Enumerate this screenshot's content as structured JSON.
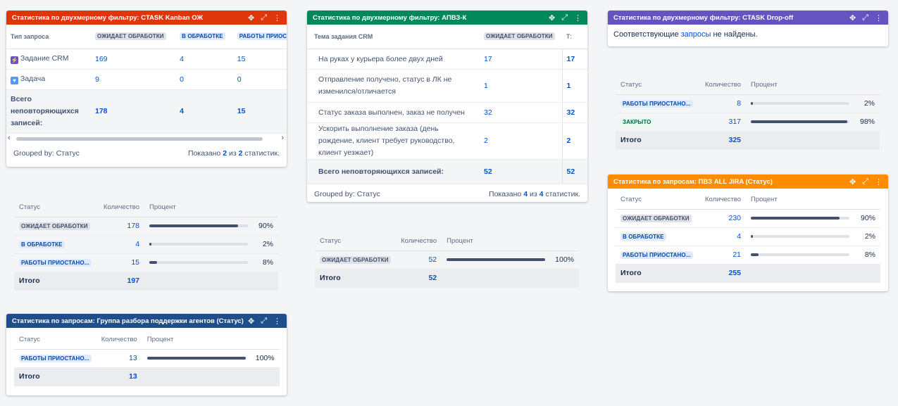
{
  "g1": {
    "title": "Статистика по двухмерному фильтру: CTASK Kanban ОЖ",
    "color": "#de350b",
    "col0": "Тип запроса",
    "cols": [
      "ОЖИДАЕТ ОБРАБОТКИ",
      "В ОБРАБОТКЕ",
      "РАБОТЫ ПРИОСТАН"
    ],
    "rows": [
      {
        "icon": "crm-task-icon",
        "name": "Задание CRM",
        "v": [
          "169",
          "4",
          "15"
        ]
      },
      {
        "icon": "task-icon",
        "name": "Задача",
        "v": [
          "9",
          "0",
          "0"
        ]
      }
    ],
    "total_label": "Всего неповторяющихся записей:",
    "total_v": [
      "178",
      "4",
      "15"
    ],
    "grouped": "Grouped by: Статус",
    "shown_pre": "Показано",
    "shown_a": "2",
    "shown_mid": "из",
    "shown_b": "2",
    "shown_post": "статистик."
  },
  "s1": {
    "h": [
      "Статус",
      "Количество",
      "Процент"
    ],
    "rows": [
      {
        "status": "ОЖИДАЕТ ОБРАБОТКИ",
        "style": "grey",
        "count": "178",
        "fill": 0.9,
        "pct": "90%"
      },
      {
        "status": "В ОБРАБОТКЕ",
        "style": "blue",
        "count": "4",
        "fill": 0.02,
        "pct": "2%"
      },
      {
        "status": "РАБОТЫ ПРИОСТАНО...",
        "style": "blue",
        "count": "15",
        "fill": 0.08,
        "pct": "8%"
      }
    ],
    "total_label": "Итого",
    "total": "197"
  },
  "g2": {
    "title": "Статистика по запросам: Группа разбора поддержки агентов (Статус)",
    "color": "#1f4e8c",
    "h": [
      "Статус",
      "Количество",
      "Процент"
    ],
    "rows": [
      {
        "status": "РАБОТЫ ПРИОСТАНО...",
        "style": "blue",
        "count": "13",
        "fill": 1.0,
        "pct": "100%"
      }
    ],
    "total_label": "Итого",
    "total": "13"
  },
  "g3": {
    "title": "Статистика по двухмерному фильтру: АПВЗ-К",
    "color": "#00875a",
    "col0": "Тема задания CRM",
    "col1": "ОЖИДАЕТ ОБРАБОТКИ",
    "col2": "Т:",
    "rows": [
      {
        "name": "На руках у курьера более двух дней",
        "v": "17",
        "t": "17"
      },
      {
        "name": "Отправление получено, статус в ЛК не изменился/отличается",
        "v": "1",
        "t": "1"
      },
      {
        "name": "Статус заказа выполнен, заказ не получен",
        "v": "32",
        "t": "32"
      },
      {
        "name": "Ускорить выполнение заказа (день рождение, клиент требует руководство, клиент уезжает)",
        "v": "2",
        "t": "2"
      }
    ],
    "total_label": "Всего неповторяющихся записей:",
    "total_v": "52",
    "total_t": "52",
    "grouped": "Grouped by: Статус",
    "shown_pre": "Показано",
    "shown_a": "4",
    "shown_mid": "из",
    "shown_b": "4",
    "shown_post": "статистик."
  },
  "s3": {
    "h": [
      "Статус",
      "Количество",
      "Процент"
    ],
    "rows": [
      {
        "status": "ОЖИДАЕТ ОБРАБОТКИ",
        "style": "grey",
        "count": "52",
        "fill": 1.0,
        "pct": "100%"
      }
    ],
    "total_label": "Итого",
    "total": "52"
  },
  "g4": {
    "title": "Статистика по двухмерному фильтру: CTASK Drop-off",
    "color": "#6554c0",
    "msg_pre": "Соответствующие",
    "msg_link": "запросы",
    "msg_post": "не найдены."
  },
  "s4": {
    "h": [
      "Статус",
      "Количество",
      "Процент"
    ],
    "rows": [
      {
        "status": "РАБОТЫ ПРИОСТАНО...",
        "style": "blue",
        "count": "8",
        "fill": 0.02,
        "pct": "2%"
      },
      {
        "status": "ЗАКРЫТО",
        "style": "green",
        "count": "317",
        "fill": 0.98,
        "pct": "98%"
      }
    ],
    "total_label": "Итого",
    "total": "325"
  },
  "g5": {
    "title": "Статистика по запросам: ПВЗ ALL JIRA (Статус)",
    "color": "#ff8b00",
    "h": [
      "Статус",
      "Количество",
      "Процент"
    ],
    "rows": [
      {
        "status": "ОЖИДАЕТ ОБРАБОТКИ",
        "style": "grey",
        "count": "230",
        "fill": 0.9,
        "pct": "90%"
      },
      {
        "status": "В ОБРАБОТКЕ",
        "style": "blue",
        "count": "4",
        "fill": 0.02,
        "pct": "2%"
      },
      {
        "status": "РАБОТЫ ПРИОСТАНО...",
        "style": "blue",
        "count": "21",
        "fill": 0.08,
        "pct": "8%"
      }
    ],
    "total_label": "Итого",
    "total": "255"
  },
  "icons": {
    "move": "✥",
    "expand": "⤢",
    "menu": "⋮"
  }
}
